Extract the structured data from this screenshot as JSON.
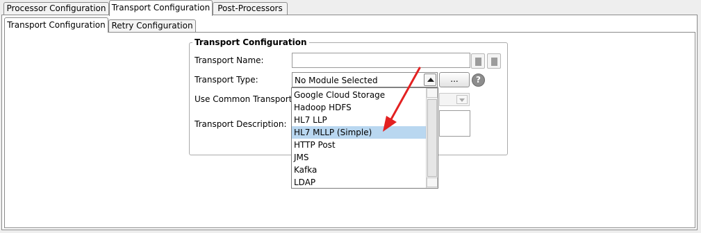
{
  "top_tabs": [
    "Processor Configuration",
    "Transport Configuration",
    "Post-Processors"
  ],
  "sub_tabs": [
    "Transport Configuration",
    "Retry Configuration"
  ],
  "group": {
    "title": "Transport Configuration",
    "labels": {
      "name": "Transport Name:",
      "type": "Transport Type:",
      "common": "Use Common Transport",
      "description": "Transport Description:"
    },
    "transport_name_value": "",
    "transport_type_value": "No Module Selected",
    "ellipsis_label": "...",
    "help_glyph": "?"
  },
  "dropdown": {
    "items": [
      "Google Cloud Storage",
      "Hadoop HDFS",
      "HL7 LLP",
      "HL7 MLLP (Simple)",
      "HTTP Post",
      "JMS",
      "Kafka",
      "LDAP"
    ],
    "selected": "HL7 MLLP (Simple)"
  },
  "annotation": {
    "arrow_color": "#e32121"
  }
}
